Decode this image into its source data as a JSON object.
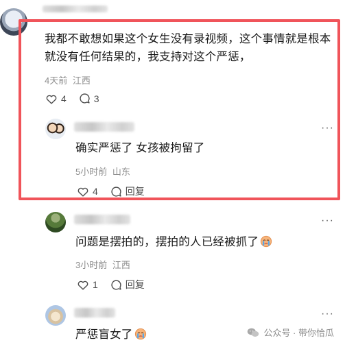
{
  "main_comment": {
    "text": "我都不敢想如果这个女生没有录视频，这个事情就是根本就没有任何结果的，我支持对这个严惩，",
    "time": "4天前",
    "location": "江西",
    "likes": "4",
    "replies": "3"
  },
  "replies": [
    {
      "text": "确实严惩了 女孩被拘留了",
      "time": "5小时前",
      "location": "山东",
      "likes": "4",
      "reply_label": "回复"
    },
    {
      "text": "问题是摆拍的，摆拍的人已经被抓了",
      "time": "3小时前",
      "location": "江西",
      "likes": "1",
      "reply_label": "回复"
    },
    {
      "text": "严惩盲女了",
      "time": "",
      "location": "",
      "likes": "",
      "reply_label": ""
    }
  ],
  "watermark": {
    "text": "公众号 · 带你恰瓜"
  },
  "colors": {
    "highlight": "#f0545a"
  },
  "more_symbol": "···"
}
